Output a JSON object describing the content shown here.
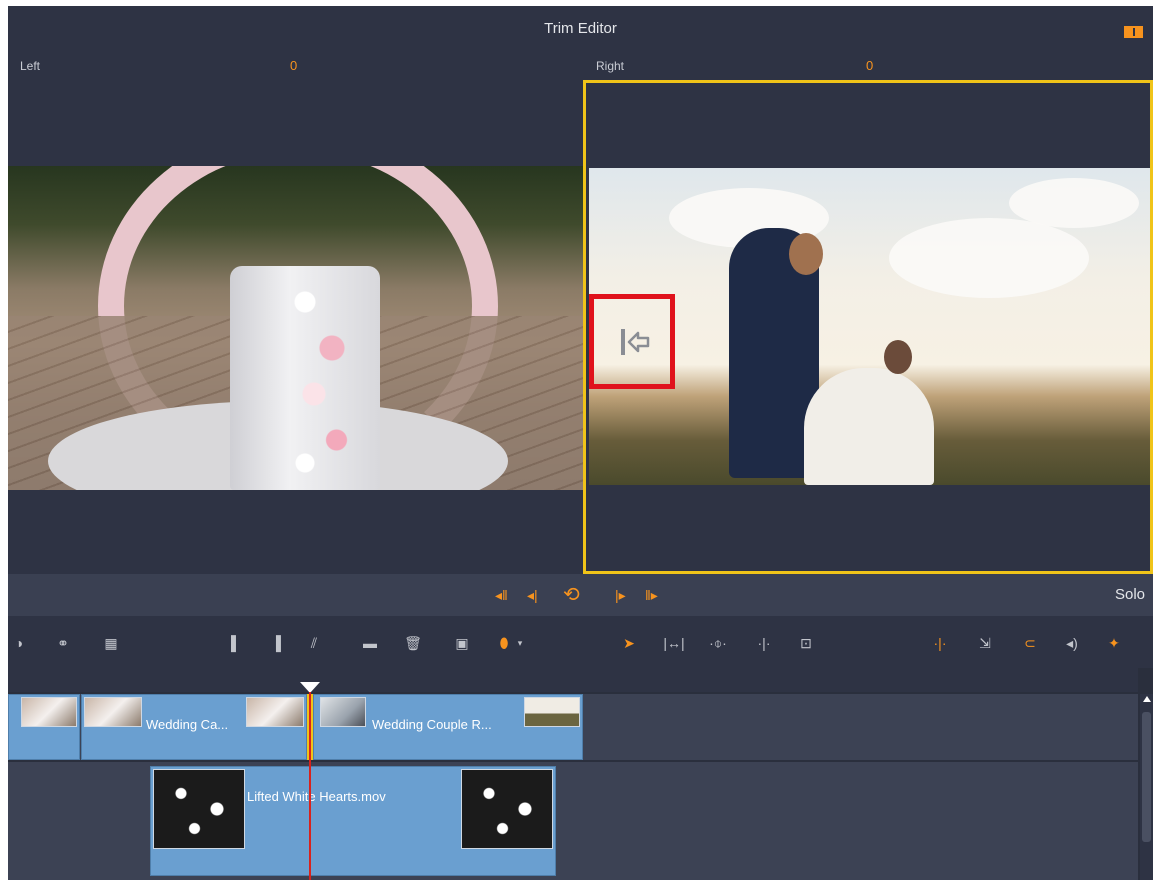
{
  "window": {
    "title": "Trim Editor"
  },
  "monitors": {
    "left": {
      "label": "Left",
      "value": "0"
    },
    "right": {
      "label": "Right",
      "value": "0"
    }
  },
  "player": {
    "buttons": [
      {
        "name": "go-to-start",
        "glyph": "◂‖"
      },
      {
        "name": "step-back",
        "glyph": "◂|"
      },
      {
        "name": "loop",
        "glyph": "⟲"
      },
      {
        "name": "step-forward",
        "glyph": "|▸"
      },
      {
        "name": "go-to-end",
        "glyph": "‖▸"
      }
    ],
    "solo_label": "Solo"
  },
  "timeline": {
    "video_track": {
      "clips": [
        {
          "name": ""
        },
        {
          "name": "Wedding Ca..."
        },
        {
          "name": "Wedding Couple R..."
        }
      ]
    },
    "overlay_track": {
      "clips": [
        {
          "name": "Lifted White Hearts.mov"
        }
      ]
    }
  },
  "colors": {
    "accent": "#f7931e",
    "selection": "#f0c419",
    "highlight": "#e0121c",
    "clip": "#6a9fd0",
    "background": "#2e3344"
  },
  "icons": {
    "trim_indicator": "trim-left-arrow-icon"
  }
}
